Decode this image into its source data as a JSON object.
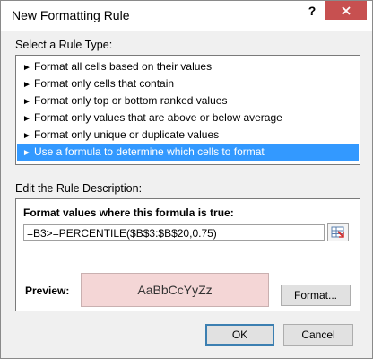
{
  "dialog": {
    "title": "New Formatting Rule",
    "help_label": "?",
    "close_label": "✕"
  },
  "rule_type": {
    "label": "Select a Rule Type:",
    "items": [
      {
        "label": "Format all cells based on their values"
      },
      {
        "label": "Format only cells that contain"
      },
      {
        "label": "Format only top or bottom ranked values"
      },
      {
        "label": "Format only values that are above or below average"
      },
      {
        "label": "Format only unique or duplicate values"
      },
      {
        "label": "Use a formula to determine which cells to format",
        "selected": true
      }
    ],
    "arrow_glyph": "►"
  },
  "description": {
    "label": "Edit the Rule Description:",
    "formula_label": "Format values where this formula is true:",
    "formula_value": "=B3>=PERCENTILE($B$3:$B$20,0.75)",
    "preview_label": "Preview:",
    "preview_text": "AaBbCcYyZz",
    "format_button": "Format..."
  },
  "buttons": {
    "ok": "OK",
    "cancel": "Cancel"
  },
  "colors": {
    "selection": "#3399ff",
    "preview_fill": "#f4d6d6",
    "close_button": "#c75050"
  }
}
